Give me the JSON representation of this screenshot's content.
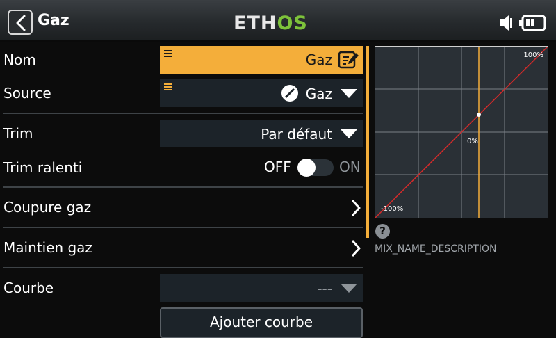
{
  "header": {
    "title": "Gaz",
    "logo_part1": "ETH",
    "logo_part2": "OS"
  },
  "form": {
    "name_label": "Nom",
    "name_value": "Gaz",
    "source_label": "Source",
    "source_value": "Gaz",
    "trim_label": "Trim",
    "trim_value": "Par défaut",
    "trim_idle_label": "Trim ralenti",
    "trim_idle_off": "OFF",
    "trim_idle_on": "ON",
    "trim_idle_state": false,
    "throttle_cut_label": "Coupure gaz",
    "throttle_hold_label": "Maintien gaz",
    "curve_label": "Courbe",
    "curve_value": "---",
    "add_curve_label": "Ajouter courbe"
  },
  "curve_preview": {
    "label_max": "100%",
    "label_mid": "0%",
    "label_min": "-100%",
    "colors": {
      "curve": "#d42a2a",
      "cursor": "#f4ae3a",
      "grid": "#7a8087"
    }
  },
  "description": "MIX_NAME_DESCRIPTION",
  "colors": {
    "accent": "#f4ae3a",
    "field_bg": "#1c2329",
    "logo_green": "#7dc23a"
  },
  "icons": {
    "back": "back-arrow-icon",
    "speaker": "speaker-icon",
    "battery": "battery-icon",
    "drag": "drag-handle-icon",
    "edit": "edit-icon",
    "source": "source-slash-icon",
    "dropdown": "caret-down-icon",
    "chevron": "chevron-right-icon",
    "help": "help-icon"
  }
}
